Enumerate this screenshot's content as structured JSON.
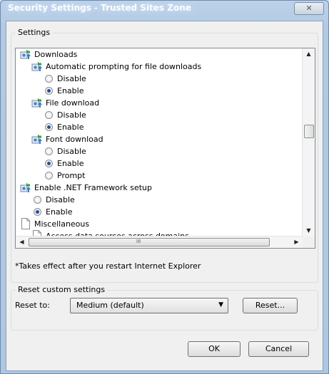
{
  "window": {
    "title": "Security Settings - Trusted Sites Zone",
    "close_glyph": "✕"
  },
  "settings": {
    "group_label": "Settings",
    "items": [
      {
        "text": "Downloads",
        "icon": "gear-icon"
      },
      {
        "text": "Automatic prompting for file downloads",
        "icon": "gear-icon"
      },
      {
        "text": "Disable",
        "checked": false
      },
      {
        "text": "Enable",
        "checked": true
      },
      {
        "text": "File download",
        "icon": "gear-icon"
      },
      {
        "text": "Disable",
        "checked": false
      },
      {
        "text": "Enable",
        "checked": true
      },
      {
        "text": "Font download",
        "icon": "gear-icon"
      },
      {
        "text": "Disable",
        "checked": false
      },
      {
        "text": "Enable",
        "checked": true
      },
      {
        "text": "Prompt",
        "checked": false
      },
      {
        "text": "Enable .NET Framework setup",
        "icon": "gear-icon"
      },
      {
        "text": "Disable",
        "checked": false
      },
      {
        "text": "Enable",
        "checked": true
      },
      {
        "text": "Miscellaneous",
        "icon": "page-icon"
      },
      {
        "text": "Access data sources across domains",
        "icon": "page-icon"
      }
    ],
    "scroll_up": "▲",
    "scroll_down": "▼",
    "scroll_left": "◀",
    "scroll_right": "▶",
    "h_thumb_grip": "III",
    "note": "*Takes effect after you restart Internet Explorer"
  },
  "reset": {
    "group_label": "Reset custom settings",
    "label": "Reset to:",
    "selected": "Medium (default)",
    "dropdown_arrow": "▼",
    "button": "Reset..."
  },
  "footer": {
    "ok": "OK",
    "cancel": "Cancel"
  }
}
